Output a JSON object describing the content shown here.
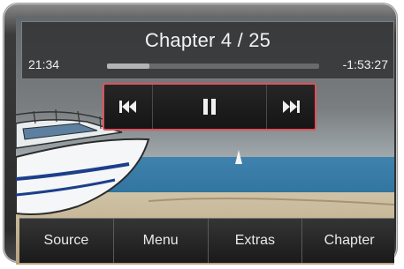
{
  "player": {
    "chapter_title": "Chapter 4 / 25",
    "elapsed": "21:34",
    "remaining": "-1:53:27",
    "progress_fraction": 0.2
  },
  "transport": {
    "previous_icon": "skip-previous-icon",
    "pause_icon": "pause-icon",
    "next_icon": "skip-next-icon",
    "highlight_color": "#e0505a"
  },
  "menu": {
    "items": [
      {
        "label": "Source"
      },
      {
        "label": "Menu"
      },
      {
        "label": "Extras"
      },
      {
        "label": "Chapter"
      }
    ]
  }
}
